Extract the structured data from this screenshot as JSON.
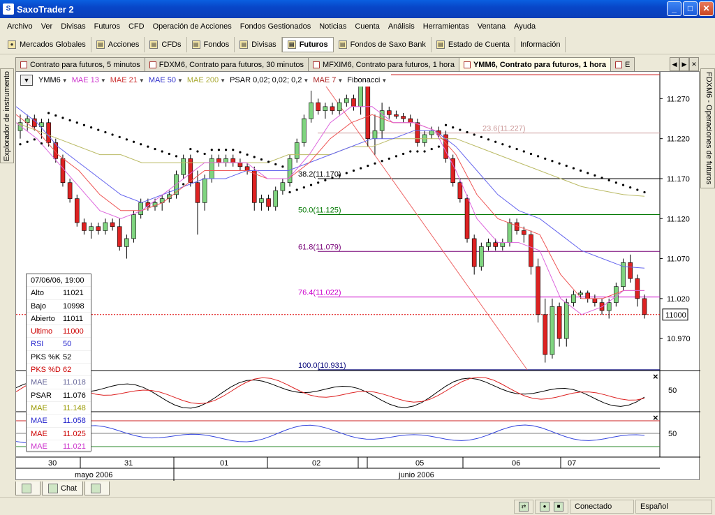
{
  "window": {
    "title": "SaxoTrader 2",
    "controls": {
      "minimize": "_",
      "maximize": "□",
      "close": "✕"
    }
  },
  "menu": [
    "Archivo",
    "Ver",
    "Divisas",
    "Futuros",
    "CFD",
    "Operación de Acciones",
    "Fondos Gestionados",
    "Noticias",
    "Cuenta",
    "Análisis",
    "Herramientas",
    "Ventana",
    "Ayuda"
  ],
  "toolbar": [
    {
      "label": "Mercados Globales",
      "icon": "globe-icon",
      "glyph": "●"
    },
    {
      "label": "Acciones",
      "icon": "stocks-icon",
      "glyph": "▤"
    },
    {
      "label": "CFDs",
      "icon": "cfd-icon",
      "glyph": "▤"
    },
    {
      "label": "Fondos",
      "icon": "funds-icon",
      "glyph": "▤"
    },
    {
      "label": "Divisas",
      "icon": "fx-icon",
      "glyph": "▤"
    },
    {
      "label": "Futuros",
      "icon": "futures-icon",
      "glyph": "▤",
      "active": true
    },
    {
      "label": "Fondos de Saxo Bank",
      "icon": "saxo-funds-icon",
      "glyph": "▤"
    },
    {
      "label": "Estado de Cuenta",
      "icon": "account-icon",
      "glyph": "▤"
    },
    {
      "label": "Información",
      "icon": "info-icon",
      "glyph": ""
    }
  ],
  "tabs": [
    {
      "label": "Contrato para futuros, 5 minutos",
      "active": false
    },
    {
      "label": "FDXM6, Contrato para futuros, 30 minutos",
      "active": false
    },
    {
      "label": "MFXIM6, Contrato para futuros, 1 hora",
      "active": false
    },
    {
      "label": "YMM6, Contrato para futuros, 1 hora",
      "active": true
    },
    {
      "label": "E",
      "active": false
    }
  ],
  "side_left": "Explorador de instrumento",
  "side_right": "FDXM6 - Operaciones de futuros",
  "chart_toolbar": {
    "instrument": "YMM6",
    "indicators": [
      {
        "label": "MAE 13",
        "color": "#cc33cc"
      },
      {
        "label": "MAE 21",
        "color": "#cc3333"
      },
      {
        "label": "MAE 50",
        "color": "#3333cc"
      },
      {
        "label": "MAE 200",
        "color": "#aaaa33"
      },
      {
        "label": "PSAR 0,02; 0,02; 0,2",
        "color": "#000000"
      },
      {
        "label": "MAE 7",
        "color": "#aa2222"
      },
      {
        "label": "Fibonacci",
        "color": "#000000"
      }
    ]
  },
  "info_box": {
    "date": "07/06/06, 19:00",
    "rows": [
      {
        "label": "Alto",
        "value": "11021",
        "color": "#000000"
      },
      {
        "label": "Bajo",
        "value": "10998",
        "color": "#000000"
      },
      {
        "label": "Abierto",
        "value": "11011",
        "color": "#000000"
      },
      {
        "label": "Ultimo",
        "value": "11000",
        "color": "#cc0000"
      },
      {
        "label": "RSI",
        "value": "50",
        "color": "#2222cc"
      },
      {
        "label": "PKS %K",
        "value": "52",
        "color": "#000000"
      },
      {
        "label": "PKS %D",
        "value": "62",
        "color": "#cc0000"
      },
      {
        "label": "MAE",
        "value": "11.018",
        "color": "#666699"
      },
      {
        "label": "PSAR",
        "value": "11.076",
        "color": "#000000"
      },
      {
        "label": "MAE",
        "value": "11.148",
        "color": "#999900"
      },
      {
        "label": "MAE",
        "value": "11.058",
        "color": "#2222cc"
      },
      {
        "label": "MAE",
        "value": "11.025",
        "color": "#cc0000"
      },
      {
        "label": "MAE",
        "value": "11.021",
        "color": "#cc33cc"
      }
    ]
  },
  "bottom_tabs": [
    {
      "label": "",
      "icon": "positions-icon"
    },
    {
      "label": "Chat",
      "icon": "chat-icon"
    },
    {
      "label": "",
      "icon": "orders-icon"
    }
  ],
  "statusbar": {
    "connection": "Conectado",
    "language": "Español"
  },
  "colors": {
    "up_candle": "#7fd47f",
    "down_candle": "#dd2222",
    "psar": "#000000",
    "mae13": "#dd66dd",
    "mae21": "#ee5555",
    "mae50": "#6666ee",
    "mae200": "#bbbb66"
  },
  "chart_data": {
    "type": "candlestick",
    "price_axis": {
      "ticks": [
        11.27,
        11.22,
        11.17,
        11.12,
        11.07,
        11.02,
        10.97
      ],
      "tick_labels": [
        "11.270",
        "11.220",
        "11.170",
        "11.120",
        "11.070",
        "11.020",
        "10.970"
      ],
      "range": [
        10.93,
        11.3
      ]
    },
    "current_price": {
      "value": 11.0,
      "label": "11000"
    },
    "fibonacci": [
      {
        "level": "23.6",
        "price": 11.227,
        "label": "23.6(11.227)",
        "color": "#cc9999"
      },
      {
        "level": "38.2",
        "price": 11.17,
        "label": "38.2(11.170)",
        "color": "#000000"
      },
      {
        "level": "50.0",
        "price": 11.125,
        "label": "50.0(11.125)",
        "color": "#007700"
      },
      {
        "level": "61.8",
        "price": 11.079,
        "label": "61.8(11.079)",
        "color": "#770077"
      },
      {
        "level": "76.4",
        "price": 11.022,
        "label": "76.4(11.022)",
        "color": "#cc00cc"
      },
      {
        "level": "100.0",
        "price": 10.931,
        "label": "100.0(10.931)",
        "color": "#000077"
      }
    ],
    "time_axis": {
      "day_labels": [
        "30",
        "31",
        "01",
        "02",
        "05",
        "06",
        "07"
      ],
      "month_labels": [
        "mayo 2006",
        "junio 2006"
      ]
    },
    "candles": [
      [
        11.23,
        11.25,
        11.22,
        11.24
      ],
      [
        11.24,
        11.25,
        11.23,
        11.245
      ],
      [
        11.245,
        11.25,
        11.23,
        11.235
      ],
      [
        11.235,
        11.245,
        11.22,
        11.24
      ],
      [
        11.24,
        11.245,
        11.21,
        11.215
      ],
      [
        11.215,
        11.22,
        11.19,
        11.195
      ],
      [
        11.195,
        11.2,
        11.16,
        11.165
      ],
      [
        11.165,
        11.17,
        11.14,
        11.145
      ],
      [
        11.145,
        11.15,
        11.11,
        11.115
      ],
      [
        11.115,
        11.12,
        11.1,
        11.105
      ],
      [
        11.105,
        11.115,
        11.095,
        11.11
      ],
      [
        11.11,
        11.115,
        11.1,
        11.105
      ],
      [
        11.105,
        11.12,
        11.1,
        11.115
      ],
      [
        11.115,
        11.12,
        11.105,
        11.11
      ],
      [
        11.11,
        11.12,
        11.08,
        11.085
      ],
      [
        11.085,
        11.1,
        11.07,
        11.095
      ],
      [
        11.095,
        11.13,
        11.09,
        11.125
      ],
      [
        11.125,
        11.145,
        11.12,
        11.14
      ],
      [
        11.14,
        11.145,
        11.13,
        11.135
      ],
      [
        11.135,
        11.145,
        11.13,
        11.14
      ],
      [
        11.14,
        11.15,
        11.13,
        11.145
      ],
      [
        11.145,
        11.155,
        11.14,
        11.15
      ],
      [
        11.15,
        11.18,
        11.145,
        11.175
      ],
      [
        11.175,
        11.2,
        11.17,
        11.195
      ],
      [
        11.195,
        11.2,
        11.16,
        11.165
      ],
      [
        11.165,
        11.18,
        11.1,
        11.14
      ],
      [
        11.14,
        11.175,
        11.13,
        11.17
      ],
      [
        11.17,
        11.2,
        11.165,
        11.195
      ],
      [
        11.195,
        11.2,
        11.185,
        11.19
      ],
      [
        11.19,
        11.2,
        11.185,
        11.195
      ],
      [
        11.195,
        11.2,
        11.185,
        11.19
      ],
      [
        11.19,
        11.195,
        11.18,
        11.185
      ],
      [
        11.185,
        11.19,
        11.175,
        11.18
      ],
      [
        11.18,
        11.185,
        11.13,
        11.14
      ],
      [
        11.14,
        11.15,
        11.13,
        11.145
      ],
      [
        11.145,
        11.15,
        11.13,
        11.135
      ],
      [
        11.135,
        11.16,
        11.13,
        11.155
      ],
      [
        11.155,
        11.17,
        11.15,
        11.165
      ],
      [
        11.165,
        11.2,
        11.16,
        11.195
      ],
      [
        11.195,
        11.22,
        11.19,
        11.215
      ],
      [
        11.215,
        11.25,
        11.21,
        11.245
      ],
      [
        11.245,
        11.28,
        11.24,
        11.265
      ],
      [
        11.265,
        11.27,
        11.25,
        11.255
      ],
      [
        11.255,
        11.265,
        11.245,
        11.26
      ],
      [
        11.26,
        11.265,
        11.25,
        11.255
      ],
      [
        11.255,
        11.27,
        11.25,
        11.265
      ],
      [
        11.265,
        11.275,
        11.26,
        11.27
      ],
      [
        11.27,
        11.275,
        11.255,
        11.26
      ],
      [
        11.26,
        11.3,
        11.25,
        11.29
      ],
      [
        11.29,
        11.3,
        11.21,
        11.22
      ],
      [
        11.22,
        11.25,
        11.2,
        11.23
      ],
      [
        11.23,
        11.265,
        11.22,
        11.255
      ],
      [
        11.255,
        11.26,
        11.245,
        11.25
      ],
      [
        11.25,
        11.255,
        11.245,
        11.248
      ],
      [
        11.248,
        11.252,
        11.24,
        11.245
      ],
      [
        11.245,
        11.25,
        11.235,
        11.24
      ],
      [
        11.24,
        11.245,
        11.21,
        11.215
      ],
      [
        11.215,
        11.23,
        11.21,
        11.225
      ],
      [
        11.225,
        11.235,
        11.22,
        11.23
      ],
      [
        11.23,
        11.235,
        11.22,
        11.225
      ],
      [
        11.225,
        11.23,
        11.19,
        11.195
      ],
      [
        11.195,
        11.2,
        11.16,
        11.165
      ],
      [
        11.165,
        11.17,
        11.14,
        11.145
      ],
      [
        11.145,
        11.15,
        11.09,
        11.095
      ],
      [
        11.095,
        11.1,
        11.05,
        11.06
      ],
      [
        11.06,
        11.09,
        11.055,
        11.085
      ],
      [
        11.085,
        11.095,
        11.08,
        11.09
      ],
      [
        11.09,
        11.095,
        11.08,
        11.085
      ],
      [
        11.085,
        11.095,
        11.08,
        11.09
      ],
      [
        11.09,
        11.12,
        11.085,
        11.115
      ],
      [
        11.115,
        11.12,
        11.1,
        11.105
      ],
      [
        11.105,
        11.11,
        11.09,
        11.1
      ],
      [
        11.1,
        11.105,
        11.05,
        11.06
      ],
      [
        11.06,
        11.07,
        10.99,
        11.0
      ],
      [
        11.0,
        11.02,
        10.94,
        10.95
      ],
      [
        10.95,
        11.02,
        10.945,
        11.01
      ],
      [
        11.01,
        11.015,
        10.96,
        10.97
      ],
      [
        10.97,
        11.02,
        10.96,
        11.015
      ],
      [
        11.015,
        11.03,
        11.01,
        11.025
      ],
      [
        11.025,
        11.03,
        11.02,
        11.027
      ],
      [
        11.027,
        11.03,
        11.015,
        11.02
      ],
      [
        11.02,
        11.025,
        11.01,
        11.015
      ],
      [
        11.015,
        11.02,
        11.0,
        11.005
      ],
      [
        11.005,
        11.02,
        10.995,
        11.015
      ],
      [
        11.015,
        11.04,
        11.01,
        11.035
      ],
      [
        11.035,
        11.07,
        11.03,
        11.065
      ],
      [
        11.065,
        11.075,
        11.04,
        11.045
      ],
      [
        11.045,
        11.05,
        11.01,
        11.02
      ],
      [
        11.02,
        11.025,
        10.995,
        11.0
      ]
    ],
    "mae13": [
      11.24,
      11.22,
      11.19,
      11.16,
      11.13,
      11.12,
      11.13,
      11.15,
      11.17,
      11.19,
      11.19,
      11.19,
      11.17,
      11.17,
      11.2,
      11.24,
      11.26,
      11.26,
      11.24,
      11.24,
      11.23,
      11.18,
      11.12,
      11.09,
      11.09,
      11.08,
      11.02,
      11.0,
      11.01,
      11.03,
      11.03
    ],
    "mae21": [
      11.25,
      11.23,
      11.2,
      11.18,
      11.15,
      11.13,
      11.13,
      11.14,
      11.16,
      11.18,
      11.18,
      11.18,
      11.17,
      11.17,
      11.19,
      11.22,
      11.24,
      11.25,
      11.24,
      11.24,
      11.23,
      11.2,
      11.15,
      11.12,
      11.11,
      11.1,
      11.05,
      11.02,
      11.02,
      11.03,
      11.03
    ],
    "mae50": [
      11.26,
      11.24,
      11.21,
      11.19,
      11.17,
      11.15,
      11.14,
      11.15,
      11.16,
      11.17,
      11.17,
      11.18,
      11.18,
      11.18,
      11.19,
      11.2,
      11.21,
      11.22,
      11.22,
      11.23,
      11.23,
      11.21,
      11.18,
      11.15,
      11.13,
      11.12,
      11.1,
      11.08,
      11.07,
      11.06,
      11.058
    ],
    "mae200": [
      11.24,
      11.23,
      11.22,
      11.21,
      11.2,
      11.2,
      11.19,
      11.19,
      11.19,
      11.19,
      11.19,
      11.19,
      11.19,
      11.2,
      11.2,
      11.2,
      11.21,
      11.21,
      11.22,
      11.22,
      11.22,
      11.22,
      11.21,
      11.2,
      11.19,
      11.18,
      11.17,
      11.16,
      11.155,
      11.15,
      11.148
    ],
    "stochastic_ticks": [
      "50"
    ],
    "rsi_ticks": [
      "50"
    ]
  }
}
